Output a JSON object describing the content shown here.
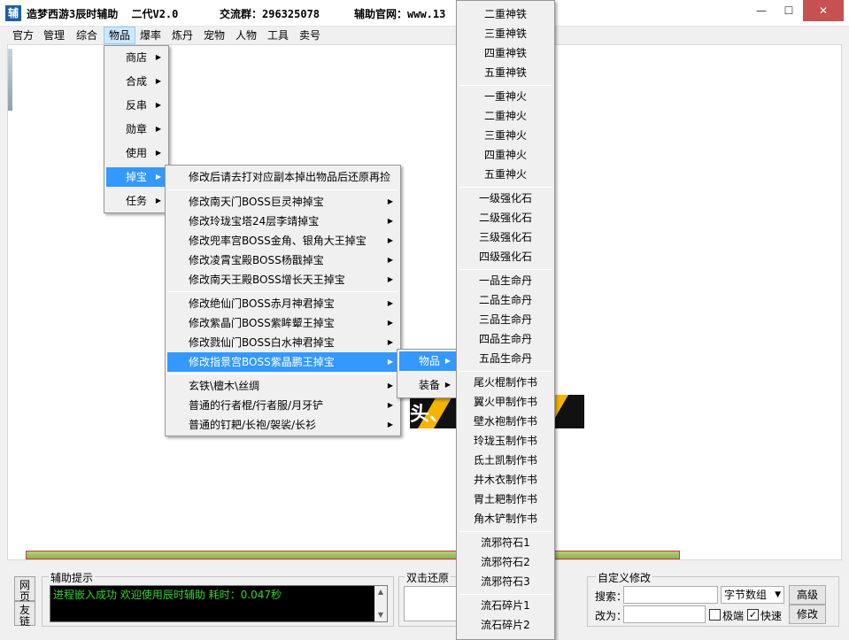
{
  "titlebar": {
    "icon_char": "辅",
    "app_name": "造梦西游3辰时辅助",
    "version": "二代V2.0",
    "group_text": "交流群：296325078",
    "site_text": "辅助官网：www.13",
    "buttons": {
      "minimize": "—",
      "maximize": "☐",
      "close": "✕"
    }
  },
  "menubar": {
    "items": [
      "官方",
      "管理",
      "综合",
      "物品",
      "爆率",
      "炼丹",
      "宠物",
      "人物",
      "工具",
      "卖号"
    ]
  },
  "menu_items": {
    "items": [
      "商店",
      "合成",
      "反串",
      "勋章",
      "使用",
      "掉宝",
      "任务"
    ]
  },
  "menu_drop": {
    "header": "修改后请去打对应副本掉出物品后还原再捡",
    "group1": [
      "修改南天门BOSS巨灵神掉宝",
      "修改玲珑宝塔24层李靖掉宝",
      "修改兜率宫BOSS金角、银角大王掉宝",
      "修改凌霄宝殿BOSS杨戬掉宝",
      "修改南天王殿BOSS增长天王掉宝"
    ],
    "group2": [
      "修改绝仙门BOSS赤月神君掉宝",
      "修改紫晶门BOSS紫眸颦王掉宝",
      "修改戮仙门BOSS白水神君掉宝",
      "修改指景宫BOSS紫晶鹏王掉宝"
    ],
    "group3": [
      "玄铁\\檀木\\丝绸",
      "普通的行者棍/行者服/月牙铲",
      "普通的钉耙/长袍/袈裟/长衫"
    ]
  },
  "menu_sub": {
    "items": [
      "物品",
      "装备"
    ]
  },
  "menu_list": {
    "group1": [
      "二重神铁",
      "三重神铁",
      "四重神铁",
      "五重神铁"
    ],
    "group2": [
      "一重神火",
      "二重神火",
      "三重神火",
      "四重神火",
      "五重神火"
    ],
    "group3": [
      "一级强化石",
      "二级强化石",
      "三级强化石",
      "四级强化石"
    ],
    "group4": [
      "一品生命丹",
      "二品生命丹",
      "三品生命丹",
      "四品生命丹",
      "五品生命丹"
    ],
    "group5": [
      "尾火棍制作书",
      "翼火甲制作书",
      "壁水袍制作书",
      "玲珑玉制作书",
      "氐土凯制作书",
      "井木衣制作书",
      "胃土耙制作书",
      "角木铲制作书"
    ],
    "group6": [
      "流邪符石1",
      "流邪符石2",
      "流邪符石3"
    ],
    "group7": [
      "流石碎片1",
      "流石碎片2"
    ]
  },
  "banner": {
    "text": "头、 板"
  },
  "progress": {
    "value": 1.0
  },
  "bottom": {
    "side_buttons": [
      "网页",
      "友链"
    ],
    "assist_label": "辅助提示",
    "console_text": "进程嵌入成功 欢迎使用辰时辅助 耗时：0.047秒",
    "restore_label": "双击还原",
    "custom_label": "自定义修改",
    "search_label": "搜索：",
    "change_label": "改为：",
    "search_value": "",
    "change_value": "",
    "type_select": "字节数组",
    "advanced_button": "高级",
    "modify_button": "修改",
    "extreme_label": "极端",
    "extreme_checked": false,
    "fast_label": "快速",
    "fast_checked": true
  },
  "colors": {
    "highlight": "#3399ff",
    "console_text": "#2fd62f",
    "progress": "#9cbb60"
  }
}
